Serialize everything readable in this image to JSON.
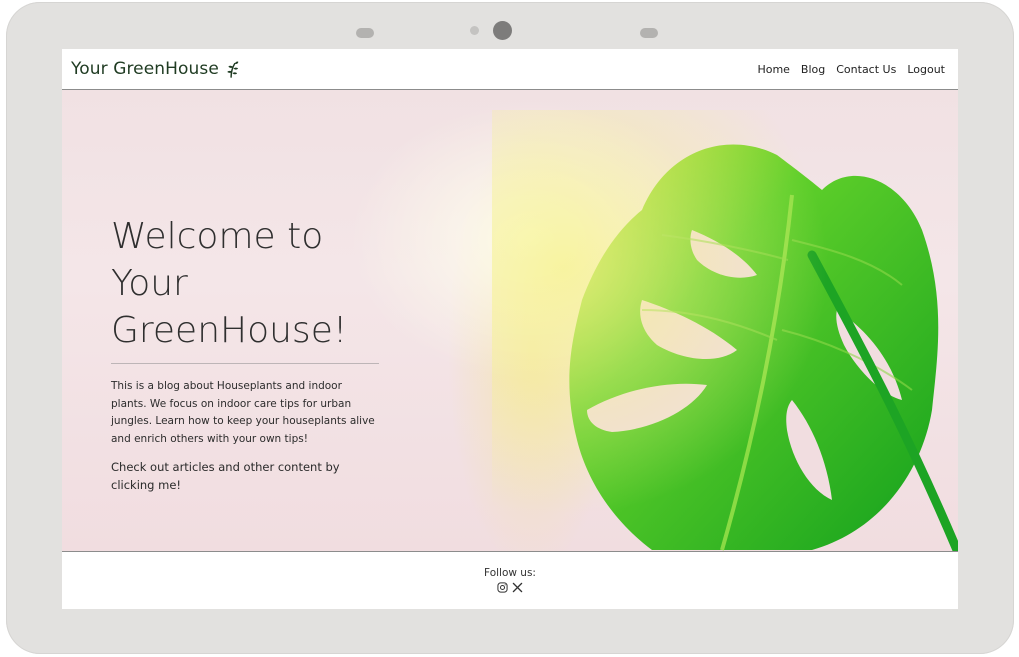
{
  "navbar": {
    "brand": "Your GreenHouse",
    "brand_icon": "seedling-icon",
    "links": [
      {
        "label": "Home"
      },
      {
        "label": "Blog"
      },
      {
        "label": "Contact Us"
      },
      {
        "label": "Logout"
      }
    ]
  },
  "hero": {
    "title_lines": [
      "Welcome to",
      "Your",
      "GreenHouse!"
    ],
    "paragraph1": "This is a blog about Houseplants and indoor plants. We focus on indoor care tips for urban jungles. Learn how to keep your houseplants alive and enrich others with your own tips!",
    "paragraph2": "Check out articles and other content by clicking me!",
    "image": "monstera-leaf-image"
  },
  "footer": {
    "follow_label": "Follow us:",
    "social_icons": [
      "instagram-icon",
      "x-twitter-icon"
    ]
  },
  "colors": {
    "brand": "#1f3b22",
    "hero_bg": "#f1e1e3",
    "leaf": "#2bb82a"
  }
}
